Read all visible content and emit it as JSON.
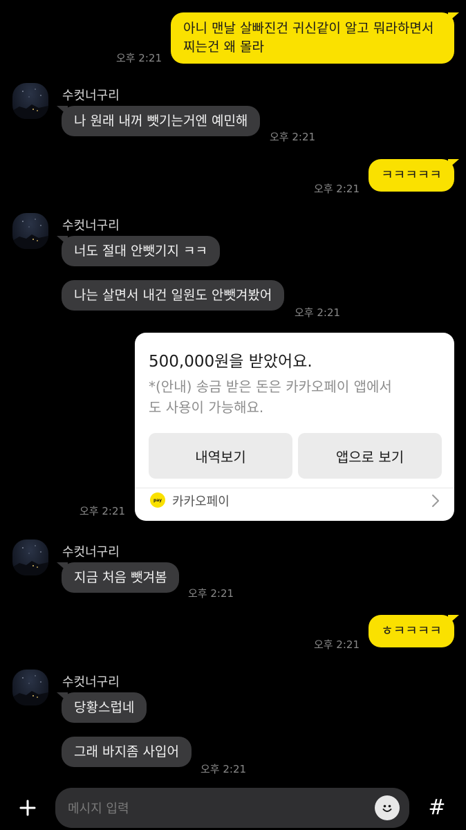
{
  "me_name": "",
  "other_name": "수컷너구리",
  "time": "오후 2:21",
  "messages": {
    "m1_line1": "아니 맨날 살빠진건 귀신같이 알고 뭐라하면서",
    "m1_line2": "찌는건 왜 몰라",
    "m2": "나 원래 내꺼 뺏기는거엔 예민해",
    "m3": "ㅋㅋㅋㅋㅋ",
    "m4": "너도 절대 안뺏기지 ㅋㅋ",
    "m5": "나는 살면서 내건 일원도 안뺏겨봤어",
    "m6": "지금 처음 뺏겨봄",
    "m7": "ㅎㅋㅋㅋㅋ",
    "m8": "당황스럽네",
    "m9": "그래 바지좀 사입어"
  },
  "pay_card": {
    "title": "500,000원을 받았어요.",
    "note_line1": "*(안내) 송금 받은 돈은 카카오페이 앱에서",
    "note_line2": "도 사용이 가능해요.",
    "btn_history": "내역보기",
    "btn_app": "앱으로 보기",
    "brand": "카카오페이",
    "logo_text": "pay"
  },
  "input": {
    "placeholder": "메시지 입력",
    "plus": "+",
    "hash": "#"
  },
  "colors": {
    "my_bubble": "#fae100",
    "other_bubble": "#3a3a3c",
    "background": "#000000"
  },
  "icons": [
    "plus-icon",
    "smile-icon",
    "hash-icon",
    "chevron-right-icon",
    "kakaopay-logo-icon"
  ]
}
